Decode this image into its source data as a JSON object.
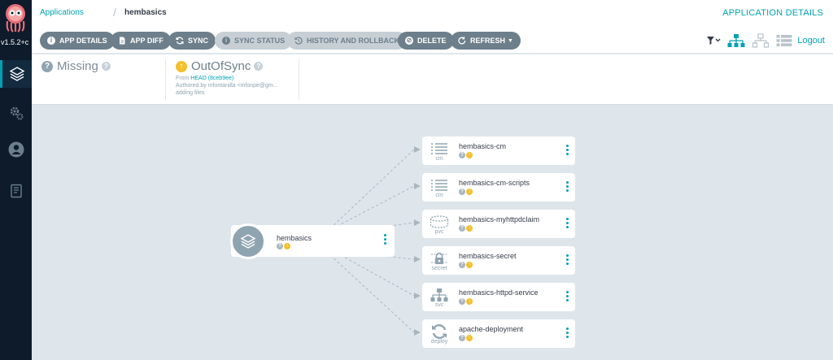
{
  "sidebar": {
    "version": "v1.5.2+c",
    "items": [
      {
        "name": "applications",
        "icon": "layers-icon",
        "active": true
      },
      {
        "name": "settings",
        "icon": "gears-icon",
        "active": false
      },
      {
        "name": "user-info",
        "icon": "user-icon",
        "active": false
      },
      {
        "name": "documentation",
        "icon": "docs-icon",
        "active": false
      }
    ]
  },
  "header": {
    "breadcrumb_root": "Applications",
    "breadcrumb_current": "hembasics",
    "title": "APPLICATION DETAILS"
  },
  "toolbar": {
    "app_details": "APP DETAILS",
    "app_diff": "APP DIFF",
    "sync": "SYNC",
    "sync_status": "SYNC STATUS",
    "history": "HISTORY AND ROLLBACK",
    "delete": "DELETE",
    "refresh": "REFRESH",
    "logout": "Logout"
  },
  "status": {
    "health": "Missing",
    "sync": "OutOfSync",
    "from_label": "From",
    "revision": "HEAD (8ceb9ee)",
    "author": "Authored by mfontanilla <mfonpe@gm...",
    "message": "adding files"
  },
  "graph": {
    "root": {
      "name": "hembasics"
    },
    "resources": [
      {
        "name": "hembasics-cm",
        "kind": "cm",
        "icon": "list-icon"
      },
      {
        "name": "hembasics-cm-scripts",
        "kind": "cm",
        "icon": "list-icon"
      },
      {
        "name": "hembasics-myhttpdclaim",
        "kind": "pvc",
        "icon": "disk-icon"
      },
      {
        "name": "hembasics-secret",
        "kind": "secret",
        "icon": "lock-icon"
      },
      {
        "name": "hembasics-httpd-service",
        "kind": "svc",
        "icon": "network-icon"
      },
      {
        "name": "apache-deployment",
        "kind": "deploy",
        "icon": "sync-icon"
      }
    ]
  },
  "colors": {
    "accent": "#00a2b3",
    "sidebar": "#0d1b2b",
    "button": "#6d7f8b",
    "out_of_sync": "#f4c030",
    "missing": "#8fa4b1"
  }
}
